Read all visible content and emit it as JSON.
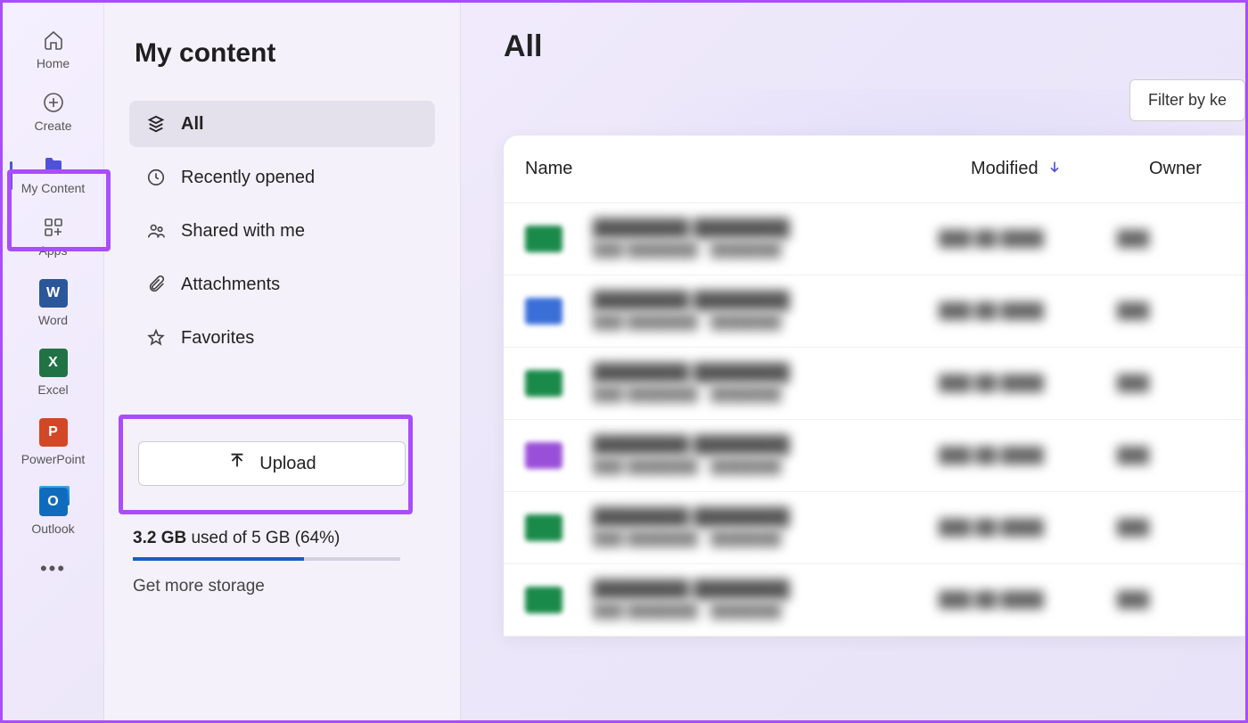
{
  "rail": {
    "items": [
      {
        "label": "Home"
      },
      {
        "label": "Create"
      },
      {
        "label": "My Content"
      },
      {
        "label": "Apps"
      },
      {
        "label": "Word"
      },
      {
        "label": "Excel"
      },
      {
        "label": "PowerPoint"
      },
      {
        "label": "Outlook"
      }
    ]
  },
  "panel": {
    "title": "My content",
    "filters": [
      {
        "label": "All"
      },
      {
        "label": "Recently opened"
      },
      {
        "label": "Shared with me"
      },
      {
        "label": "Attachments"
      },
      {
        "label": "Favorites"
      }
    ],
    "upload_label": "Upload",
    "storage": {
      "used": "3.2 GB",
      "middle": "used of 5 GB",
      "percent_label": "(64%)",
      "percent": 64,
      "more_label": "Get more storage"
    }
  },
  "main": {
    "title": "All",
    "filter_button": "Filter by ke",
    "columns": {
      "name": "Name",
      "modified": "Modified",
      "owner": "Owner"
    },
    "rows": [
      {
        "icon_color": "#1a8a4a"
      },
      {
        "icon_color": "#3a6fd8"
      },
      {
        "icon_color": "#1a8a4a"
      },
      {
        "icon_color": "#9a4fd8"
      },
      {
        "icon_color": "#1a8a4a"
      },
      {
        "icon_color": "#1a8a4a"
      }
    ]
  }
}
